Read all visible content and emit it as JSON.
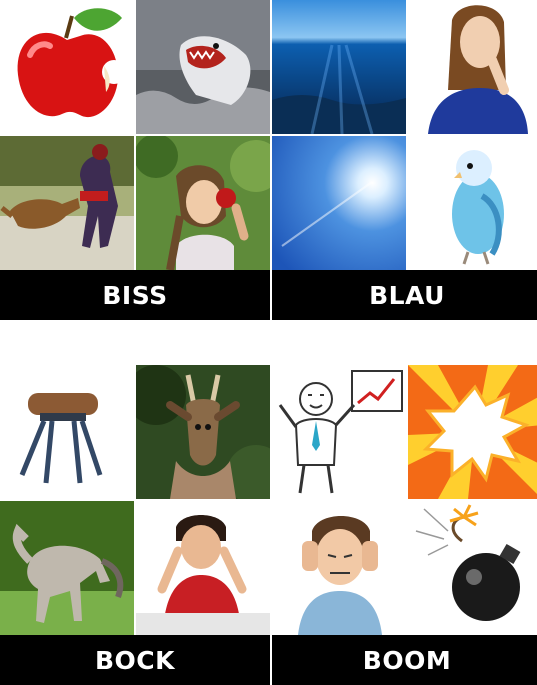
{
  "puzzles": [
    {
      "answer": "BISS",
      "tiles": [
        "apple-with-bite",
        "shark-jumping",
        "dog-biting-man",
        "girl-biting-apple"
      ]
    },
    {
      "answer": "BLAU",
      "tiles": [
        "underwater-ocean",
        "woman-thinking",
        "sun-in-blue-sky",
        "blue-budgie"
      ]
    },
    {
      "answer": "BOCK",
      "tiles": [
        "pommel-horse",
        "roe-deer",
        "rearing-horse",
        "stressed-student"
      ]
    },
    {
      "answer": "BOOM",
      "tiles": [
        "businessman-growth-chart",
        "comic-explosion",
        "boy-covering-ears",
        "bomb-with-fuse"
      ]
    }
  ]
}
